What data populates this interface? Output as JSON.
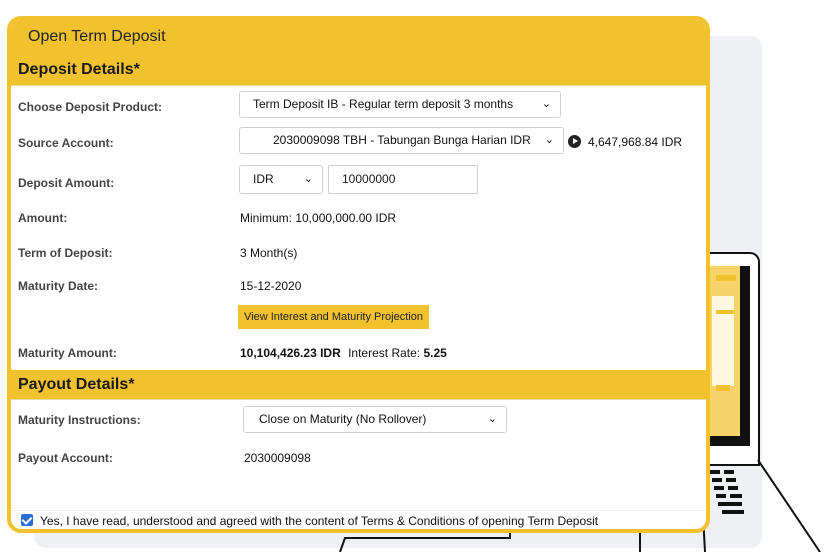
{
  "window": {
    "title": "Open Term Deposit"
  },
  "deposit_details": {
    "heading": "Deposit Details*",
    "product_label": "Choose Deposit Product:",
    "product_value": "Term Deposit IB - Regular term deposit 3 months",
    "source_label": "Source Account:",
    "source_value": "2030009098 TBH - Tabungan Bunga Harian IDR",
    "source_balance": "4,647,968.84 IDR",
    "amount_label": "Deposit Amount:",
    "currency_value": "IDR",
    "amount_value": "10000000",
    "minimum_label": "Amount:",
    "minimum_value": "Minimum: 10,000,000.00 IDR",
    "term_label": "Term of Deposit:",
    "term_value": "3 Month(s)",
    "maturity_date_label": "Maturity Date:",
    "maturity_date_value": "15-12-2020",
    "projection_button": "View Interest and Maturity Projection",
    "maturity_amount_label": "Maturity Amount:",
    "maturity_amount_value": "10,104,426.23 IDR",
    "interest_rate_label": "Interest Rate:",
    "interest_rate_value": "5.25"
  },
  "payout_details": {
    "heading": "Payout Details*",
    "instructions_label": "Maturity Instructions:",
    "instructions_value": "Close on Maturity (No Rollover)",
    "payout_account_label": "Payout Account:",
    "payout_account_value": "2030009098"
  },
  "terms": {
    "checked": true,
    "text": "Yes, I have read, understood and agreed with the content of Terms & Conditions of opening Term Deposit"
  },
  "colors": {
    "accent": "#f1c22e",
    "checkbox": "#2a6fd6",
    "background_panel": "#eef0f3"
  },
  "icons": {
    "dropdown": "chevron-down-icon",
    "balance": "play-circle-icon",
    "checkbox": "check-icon"
  }
}
